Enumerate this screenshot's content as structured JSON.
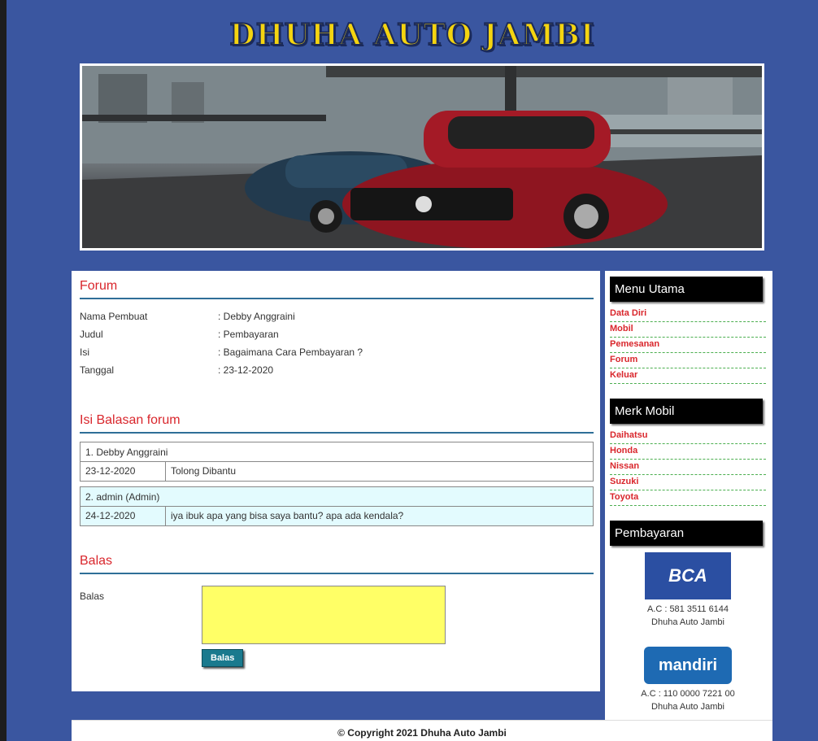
{
  "site": {
    "title": "DHUHA AUTO JAMBI"
  },
  "forum": {
    "title": "Forum",
    "rows": [
      {
        "label": "Nama Pembuat",
        "value": ": Debby Anggraini"
      },
      {
        "label": "Judul",
        "value": ": Pembayaran"
      },
      {
        "label": "Isi",
        "value": ": Bagaimana Cara Pembayaran ?"
      },
      {
        "label": "Tanggal",
        "value": ": 23-12-2020"
      }
    ]
  },
  "replies": {
    "title": "Isi Balasan forum",
    "items": [
      {
        "author": "1. Debby Anggraini",
        "date": "23-12-2020",
        "text": "Tolong Dibantu"
      },
      {
        "author": "2. admin (Admin)",
        "date": "24-12-2020",
        "text": "iya ibuk apa yang bisa saya bantu? apa ada kendala?"
      }
    ]
  },
  "reply_form": {
    "title": "Balas",
    "label": "Balas",
    "textarea_value": "",
    "button_label": "Balas"
  },
  "sidebar": {
    "menu_title": "Menu Utama",
    "menu_items": [
      "Data Diri",
      "Mobil",
      "Pemesanan",
      "Forum",
      "Keluar"
    ],
    "brand_title": "Merk Mobil",
    "brand_items": [
      "Daihatsu",
      "Honda",
      "Nissan",
      "Suzuki",
      "Toyota"
    ],
    "payment_title": "Pembayaran",
    "banks": [
      {
        "logo": "BCA",
        "account": "A.C : 581 3511 6144",
        "name": "Dhuha Auto Jambi"
      },
      {
        "logo": "mandiri",
        "account": "A.C : 110 0000 7221 00",
        "name": "Dhuha Auto Jambi"
      }
    ]
  },
  "footer": {
    "text": "© Copyright 2021 Dhuha Auto Jambi"
  }
}
